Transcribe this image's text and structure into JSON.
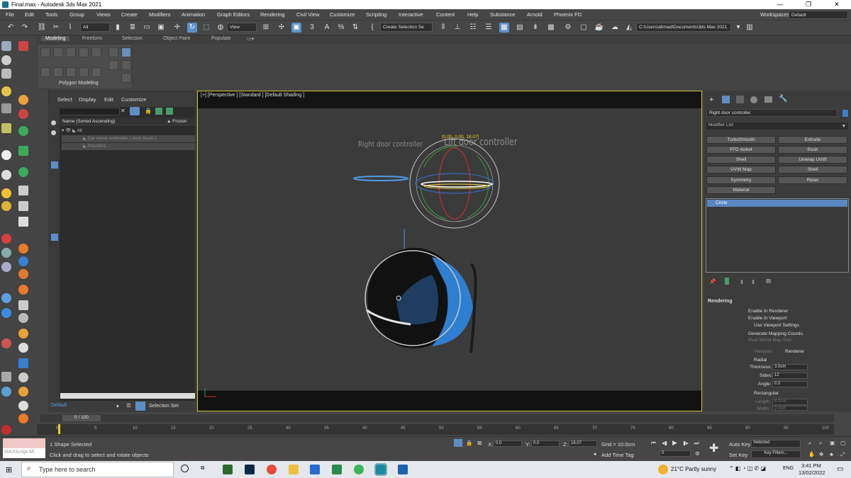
{
  "window": {
    "title": "Final.max - Autodesk 3ds Max 2021",
    "minimize": "—",
    "maximize": "❐",
    "close": "✕"
  },
  "menu": [
    "File",
    "Edit",
    "Tools",
    "Group",
    "Views",
    "Create",
    "Modifiers",
    "Animation",
    "Graph Editors",
    "Rendering",
    "Civil View",
    "Customize",
    "Scripting",
    "Interactive",
    "Content",
    "Help",
    "Substance",
    "Arnold",
    "Phoenix FD"
  ],
  "workspaces": {
    "label": "Workspaces:",
    "value": "Default"
  },
  "toolbar": {
    "filter": "All",
    "view": "View",
    "selection_set": "Create Selection Se",
    "path": "C:\\Users\\ahmad\\Documents\\3ds Max 2021",
    "snap_label": "3",
    "angle_snap": "A",
    "percent_snap": "%"
  },
  "ribbon": {
    "tabs": [
      "Modeling",
      "Freeform",
      "Selection",
      "Object Paint",
      "Populate"
    ],
    "panel_label": "Polygon Modeling"
  },
  "scene_explorer": {
    "menu": [
      "Select",
      "Display",
      "Edit",
      "Customize"
    ],
    "column_name": "Name (Sorted Ascending)",
    "column_frozen": "▲ Frozen",
    "root": "All",
    "items": [
      "Car move controller ( dont touch )",
      "Point001"
    ]
  },
  "viewport": {
    "label": "[+] [Perspective ] [Standard ] [Default Shading ]",
    "text_right_door": "Right door controller",
    "text_left_door": "Lift door controller",
    "coords_readout": "[0.00, 0.00, 18.07]"
  },
  "command_panel": {
    "object_name": "Right door controller",
    "modifier_list": "Modifier List",
    "modifiers": [
      "TurboSmooth",
      "Extrude",
      "FFD 4x4x4",
      "Push",
      "Shell",
      "Unwrap UVW",
      "UVW Map",
      "Shell",
      "Symmetry",
      "Relax",
      "Material"
    ],
    "stack_item": "Circle",
    "rollout": {
      "title": "Rendering",
      "enable_renderer": "Enable In Renderer",
      "enable_viewport": "Enable In Viewport",
      "use_viewport": "Use Viewport Settings",
      "gen_mapping": "Generate Mapping Coords.",
      "real_world": "Real-World Map Size",
      "viewport_opt": "Viewport",
      "renderer_opt": "Renderer",
      "radial": "Radial",
      "thickness_label": "Thickness:",
      "thickness": "3.0cm",
      "sides_label": "Sides:",
      "sides": "12",
      "angle_label": "Angle:",
      "angle": "0.0",
      "rectangular": "Rectangular",
      "length_label": "Length:",
      "length": "6.0cm",
      "width_label": "Width:",
      "width": "2.0cm"
    }
  },
  "timeline": {
    "frame": "0 / 100",
    "ticks": [
      "0",
      "5",
      "10",
      "15",
      "20",
      "25",
      "30",
      "35",
      "40",
      "45",
      "50",
      "55",
      "60",
      "65",
      "70",
      "75",
      "80",
      "85",
      "90",
      "95",
      "100"
    ],
    "current_frame": 0
  },
  "layer": {
    "name": "Default",
    "selection_set": "Selection Set:"
  },
  "status": {
    "maxscript": "MAXScript Mi",
    "selected": "1 Shape Selected",
    "prompt": "Click and drag to select and rotate objects",
    "x_label": "X:",
    "x": "0.0",
    "y_label": "Y:",
    "y": "0.0",
    "z_label": "Z:",
    "z": "18.07",
    "grid": "Grid = 10.0cm",
    "add_time_tag": "Add Time Tag",
    "auto_key": "Auto Key",
    "set_key": "Set Key",
    "selected_dropdown": "Selected",
    "key_filters": "Key Filters...",
    "frame_field": "0"
  },
  "taskbar": {
    "search": "Type here to search",
    "weather": "21°C  Partly sunny",
    "lang": "ENG",
    "time": "3:41 PM",
    "date": "13/02/2022"
  },
  "colors": {
    "accent": "#5b8fc4",
    "viewport_border": "#d0c040",
    "circle_blue": "#2f7fd0"
  }
}
